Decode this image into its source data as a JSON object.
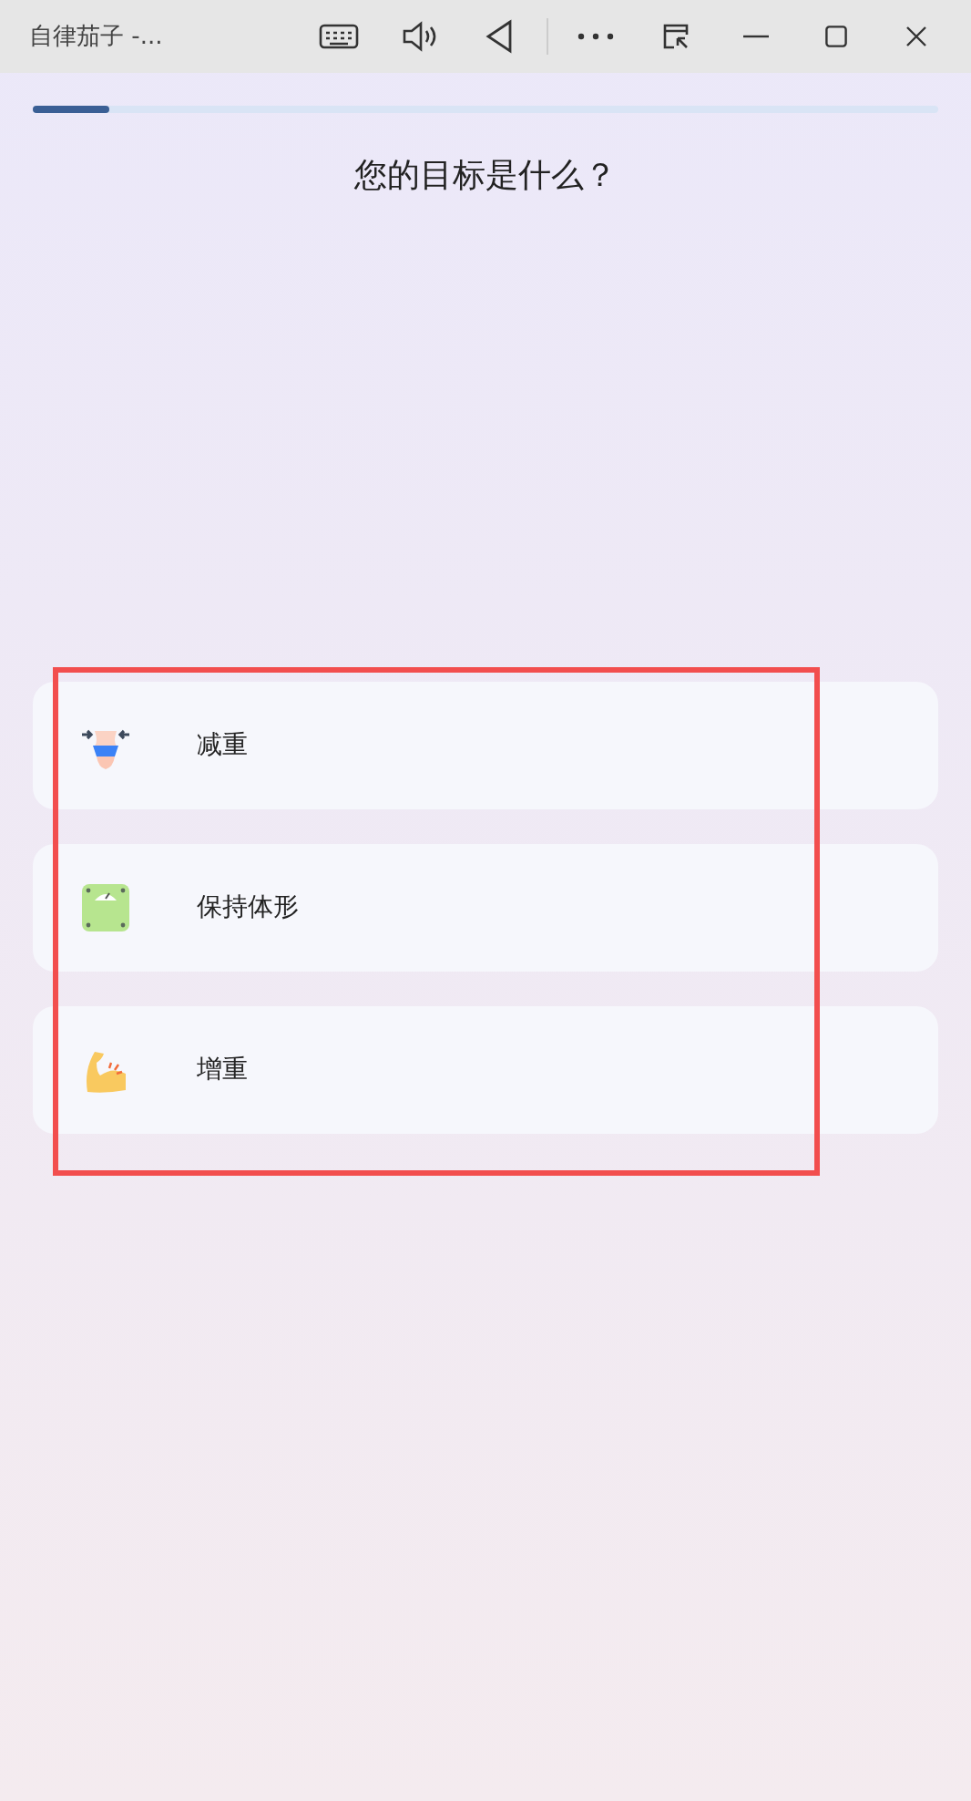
{
  "window": {
    "title": "自律茄子 -..."
  },
  "progress": {
    "level": 0.085
  },
  "question": "您的目标是什么？",
  "options": [
    {
      "kind": "waist",
      "label": "减重"
    },
    {
      "kind": "scale",
      "label": "保持体形"
    },
    {
      "kind": "arm",
      "label": "增重"
    }
  ],
  "highlight_frame": true
}
